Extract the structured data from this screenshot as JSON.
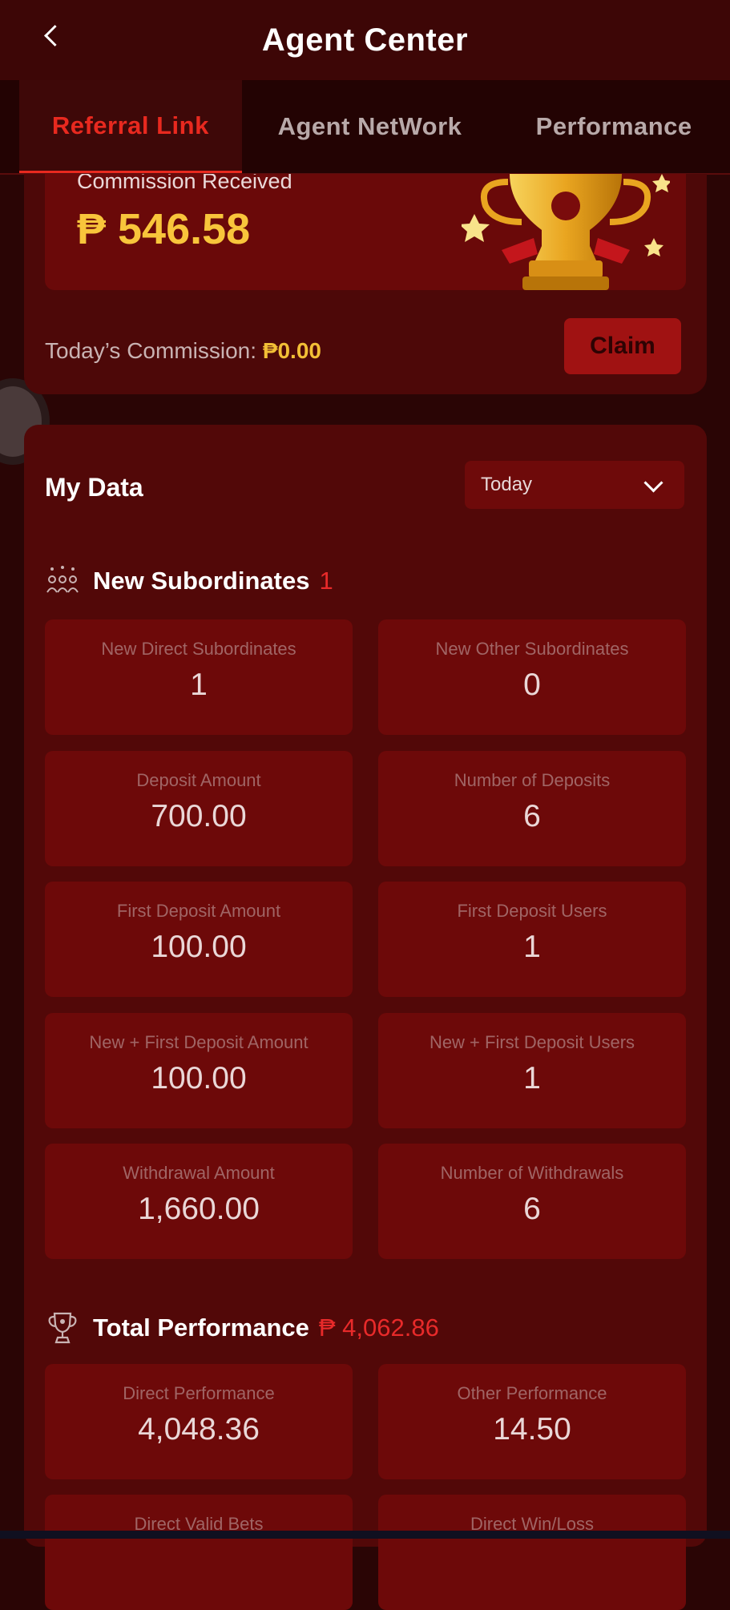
{
  "header": {
    "title": "Agent Center"
  },
  "tabs": [
    {
      "label": "Referral Link"
    },
    {
      "label": "Agent NetWork"
    },
    {
      "label": "Performance"
    }
  ],
  "commission": {
    "received_label": "Commission Received",
    "received_amount": "₱ 546.58",
    "today_label": "Today’s Commission:",
    "today_value": "₱0.00",
    "claim_label": "Claim"
  },
  "my_data": {
    "title": "My Data",
    "period": "Today"
  },
  "new_subordinates": {
    "label": "New Subordinates",
    "count": "1",
    "stats": [
      {
        "label": "New Direct Subordinates",
        "value": "1"
      },
      {
        "label": "New Other Subordinates",
        "value": "0"
      },
      {
        "label": "Deposit Amount",
        "value": "700.00"
      },
      {
        "label": "Number of Deposits",
        "value": "6"
      },
      {
        "label": "First Deposit Amount",
        "value": "100.00"
      },
      {
        "label": "First Deposit Users",
        "value": "1"
      },
      {
        "label": "New + First Deposit Amount",
        "value": "100.00"
      },
      {
        "label": "New + First Deposit Users",
        "value": "1"
      },
      {
        "label": "Withdrawal Amount",
        "value": "1,660.00"
      },
      {
        "label": "Number of Withdrawals",
        "value": "6"
      }
    ]
  },
  "total_performance": {
    "label": "Total Performance",
    "amount": "₱ 4,062.86",
    "stats": [
      {
        "label": "Direct Performance",
        "value": "4,048.36"
      },
      {
        "label": "Other Performance",
        "value": "14.50"
      },
      {
        "label": "Direct Valid Bets",
        "value": ""
      },
      {
        "label": "Direct Win/Loss",
        "value": ""
      }
    ]
  },
  "colors": {
    "accent": "#e8291f",
    "gold": "#f8c53b",
    "panel": "#520808",
    "box": "#6d0909"
  }
}
